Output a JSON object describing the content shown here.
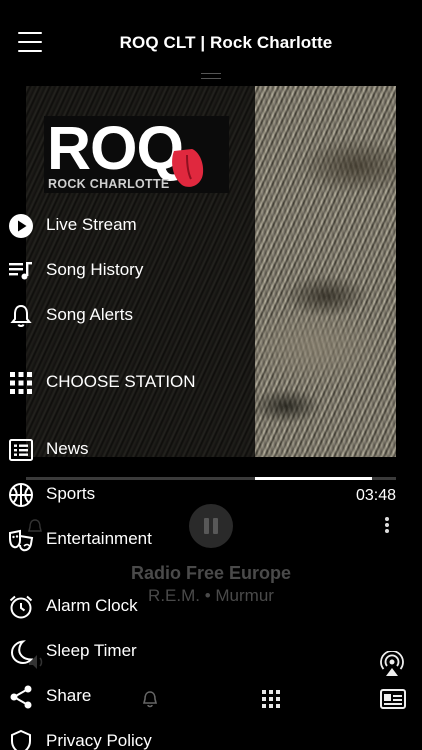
{
  "header": {
    "title": "ROQ CLT | Rock Charlotte"
  },
  "logo": {
    "main": "ROQ",
    "sub": "ROCK CHARLOTTE"
  },
  "menu": {
    "items": [
      {
        "label": "Live Stream",
        "icon": "play-circle-icon"
      },
      {
        "label": "Song History",
        "icon": "playlist-icon"
      },
      {
        "label": "Song Alerts",
        "icon": "bell-icon"
      },
      {
        "label": "CHOOSE  STATION",
        "icon": "grid-icon"
      },
      {
        "label": "News",
        "icon": "news-icon"
      },
      {
        "label": "Sports",
        "icon": "basketball-icon"
      },
      {
        "label": "Entertainment",
        "icon": "theater-masks-icon"
      },
      {
        "label": "Alarm Clock",
        "icon": "alarm-clock-icon"
      },
      {
        "label": "Sleep Timer",
        "icon": "moon-icon"
      },
      {
        "label": "Share",
        "icon": "share-icon"
      },
      {
        "label": "Privacy Policy",
        "icon": "shield-icon"
      }
    ]
  },
  "player": {
    "elapsed": "03:48",
    "progress_fraction": 0.935,
    "progress_marker_fraction": 0.62,
    "track_title": "Radio Free Europe",
    "track_subtitle": "R.E.M. • Murmur"
  },
  "colors": {
    "background": "#000000",
    "text": "#ffffff",
    "dim_text": "#4a4a4a",
    "logo_tongue": "#e0283e"
  }
}
